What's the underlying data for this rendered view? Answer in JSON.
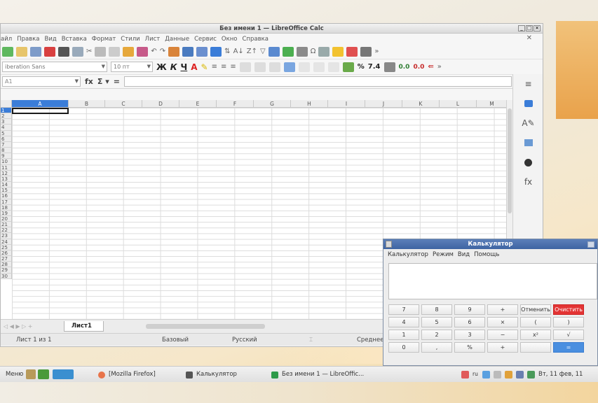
{
  "calc_window": {
    "title": "Без имени 1 — LibreOffice Calc",
    "menu": [
      "айл",
      "Правка",
      "Вид",
      "Вставка",
      "Формат",
      "Стили",
      "Лист",
      "Данные",
      "Сервис",
      "Окно",
      "Справка"
    ],
    "font_name": "iberation Sans",
    "font_size": "10 пт",
    "name_box": "A1",
    "columns": [
      "A",
      "B",
      "C",
      "D",
      "E",
      "F",
      "G",
      "H",
      "I",
      "J",
      "K",
      "L",
      "M"
    ],
    "rows": [
      "1",
      "2",
      "3",
      "4",
      "5",
      "6",
      "7",
      "8",
      "9",
      "10",
      "11",
      "12",
      "13",
      "14",
      "15",
      "16",
      "17",
      "18",
      "19",
      "20",
      "21",
      "22",
      "23",
      "24",
      "25",
      "26",
      "27",
      "28",
      "29",
      "30"
    ],
    "sheet_tab": "Лист1",
    "status": {
      "sheet": "Лист 1 из 1",
      "style": "Базовый",
      "language": "Русский",
      "average": "Среднее зн"
    },
    "format_buttons": {
      "bold": "Ж",
      "italic": "К",
      "underline": "Ч",
      "percent": "%",
      "number": "7.4",
      "decimals": "0.0"
    }
  },
  "calculator": {
    "title": "Калькулятор",
    "menu": [
      "Калькулятор",
      "Режим",
      "Вид",
      "Помощь"
    ],
    "rows": [
      [
        "7",
        "8",
        "9",
        "+",
        "Отменить",
        "Очистить"
      ],
      [
        "4",
        "5",
        "6",
        "×",
        "(",
        ")"
      ],
      [
        "1",
        "2",
        "3",
        "−",
        "x²",
        "√"
      ],
      [
        "0",
        ",",
        "%",
        "+",
        "",
        "="
      ]
    ]
  },
  "taskbar": {
    "menu": "Меню",
    "tasks": [
      "[Mozilla Firefox]",
      "Калькулятор",
      "Без имени 1 — LibreOffic..."
    ],
    "lang": "ru",
    "clock": "Вт, 11 фев, 11"
  },
  "colors": {
    "accent": "#3b7dd8",
    "clear_red": "#e33434",
    "calc_title": "#4a6fae"
  }
}
